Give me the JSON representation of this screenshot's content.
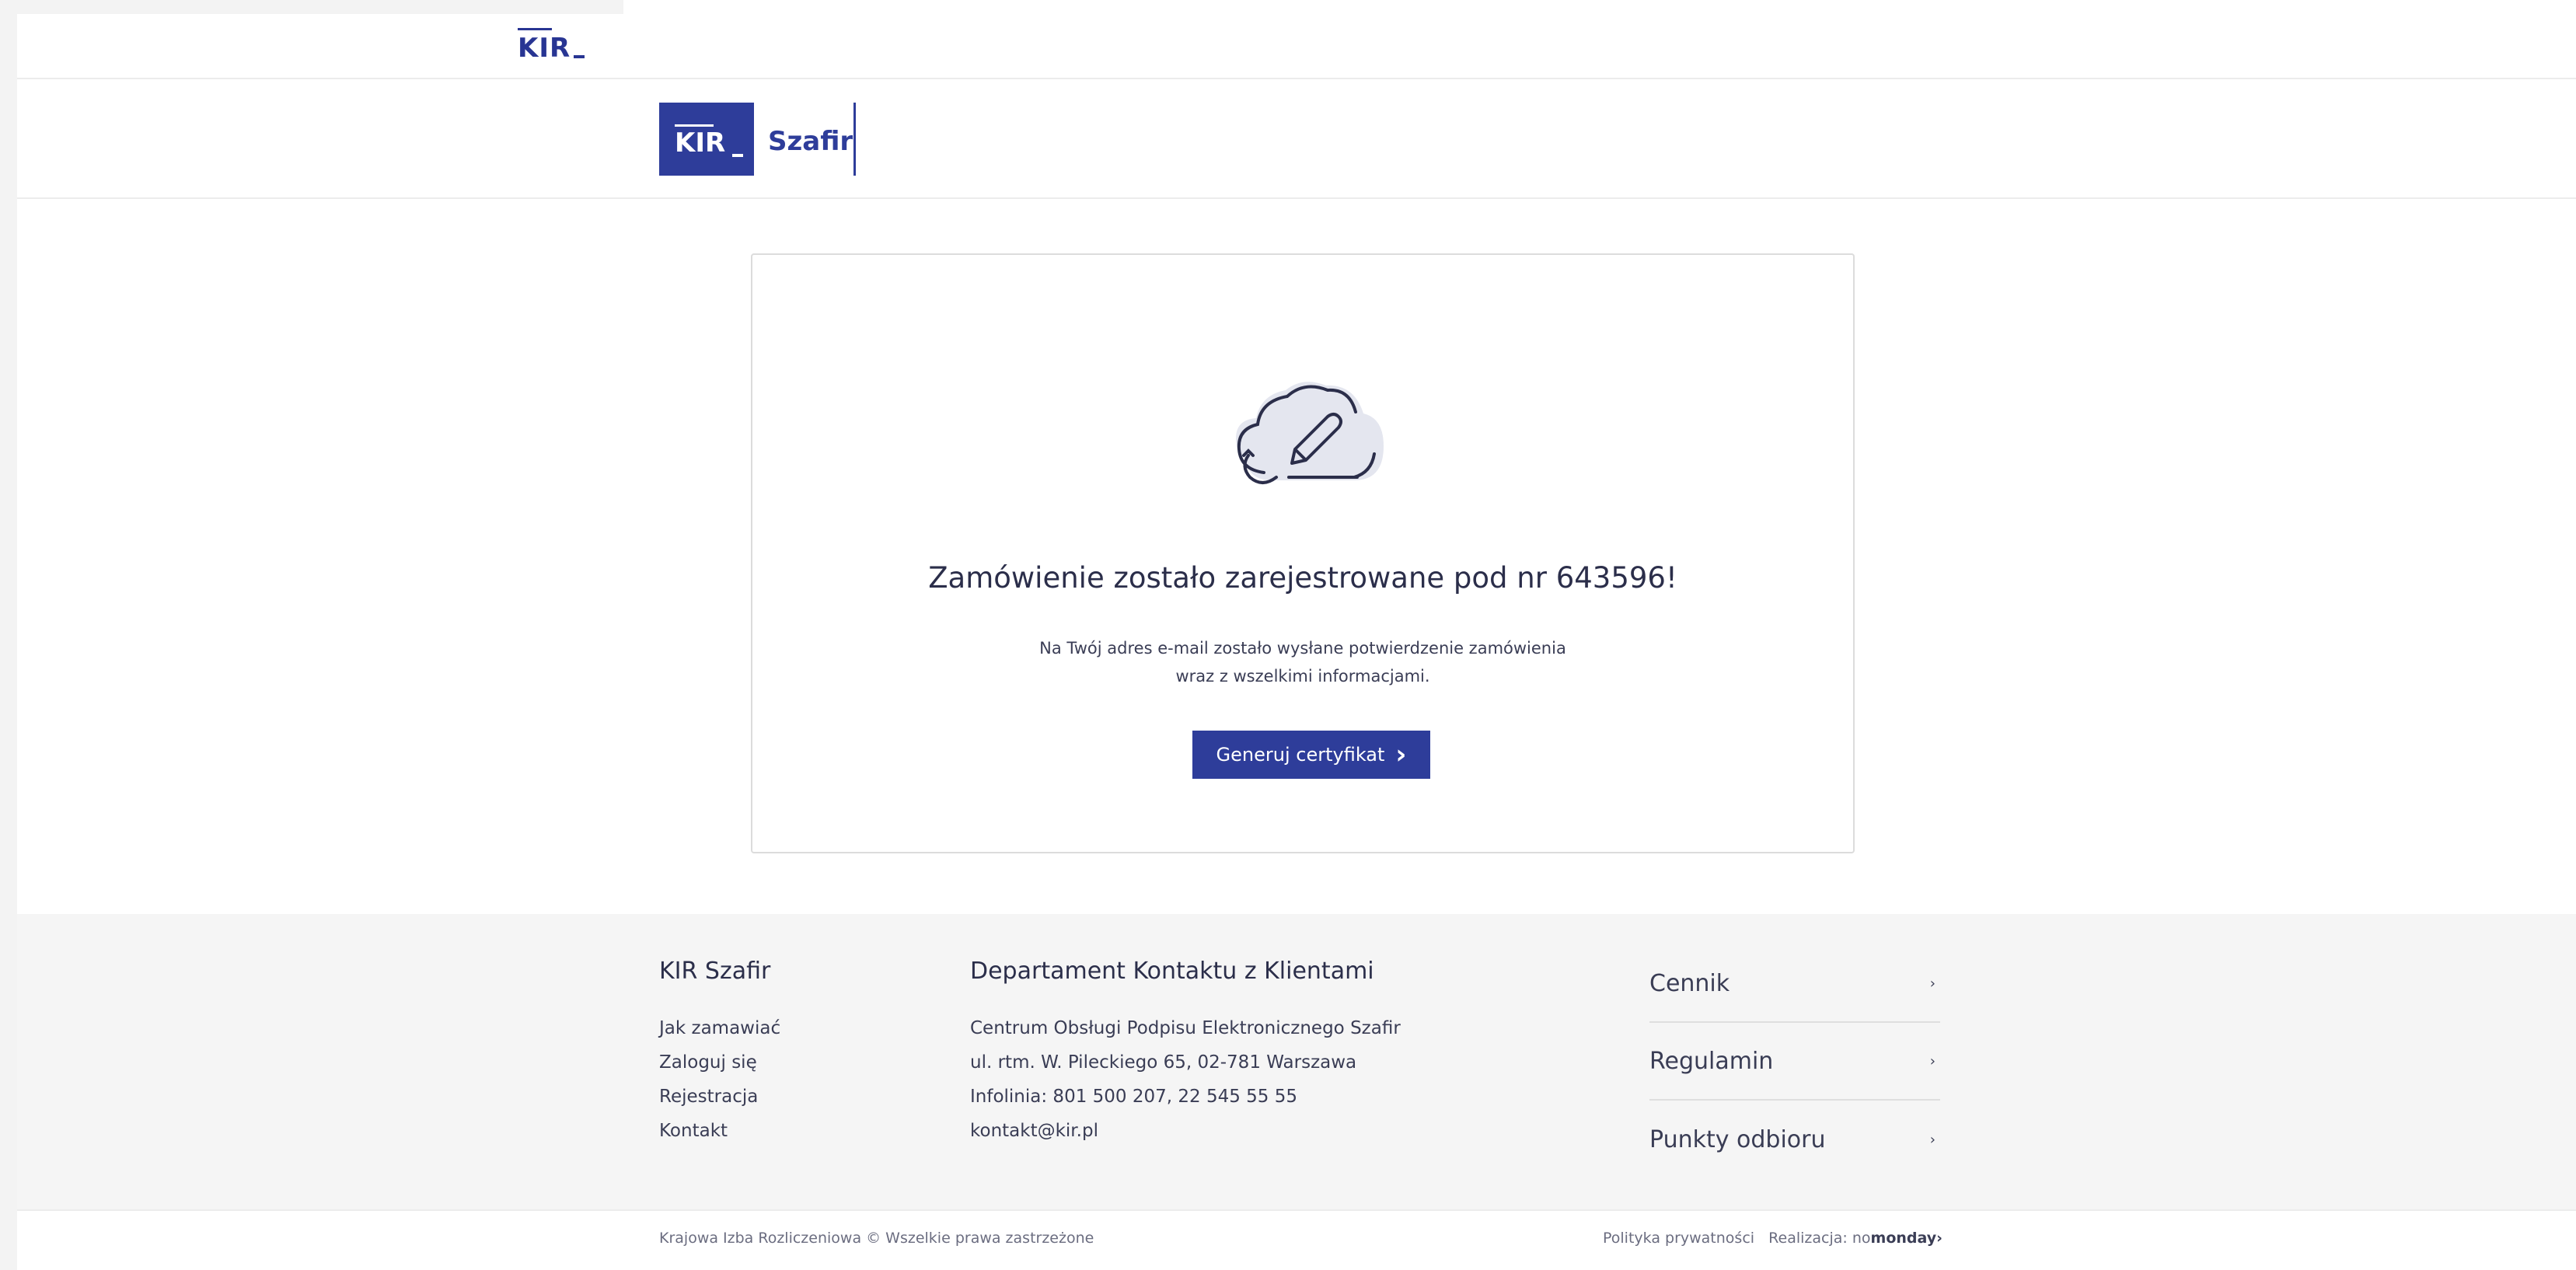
{
  "topbar": {
    "brand": "KIR"
  },
  "header": {
    "logo_mark": "KIR",
    "logo_name": "Szafir"
  },
  "card": {
    "icon": "cloud-signature-icon",
    "title": "Zamówienie zostało zarejestrowane pod nr 643596!",
    "desc_line1": "Na Twój adres e-mail zostało wysłane potwierdzenie zamówienia",
    "desc_line2": "wraz z wszelkimi informacjami.",
    "button_label": "Generuj certyfikat",
    "button_arrow": "›"
  },
  "footer": {
    "col1": {
      "title": "KIR Szafir",
      "items": [
        "Jak zamawiać",
        "Zaloguj się",
        "Rejestracja",
        "Kontakt"
      ]
    },
    "col2": {
      "title": "Departament Kontaktu z Klientami",
      "items": [
        "Centrum Obsługi Podpisu Elektronicznego Szafir",
        "ul. rtm. W. Pileckiego 65, 02-781 Warszawa",
        "Infolinia: 801 500 207, 22 545 55 55",
        "kontakt@kir.pl"
      ]
    },
    "links": [
      {
        "label": "Cennik",
        "arrow": "›"
      },
      {
        "label": "Regulamin",
        "arrow": "›"
      },
      {
        "label": "Punkty odbioru",
        "arrow": "›"
      }
    ]
  },
  "bottom": {
    "copyright": "Krajowa Izba Rozliczeniowa © Wszelkie prawa zastrzeżone",
    "privacy": "Polityka prywatności",
    "realization_label": "Realizacja:",
    "realization_no": "no",
    "realization_monday": "monday",
    "realization_arrow": "›"
  },
  "colors": {
    "brand": "#2e3d9a",
    "text": "#2b2e4a",
    "footer_bg": "#f5f5f5"
  }
}
